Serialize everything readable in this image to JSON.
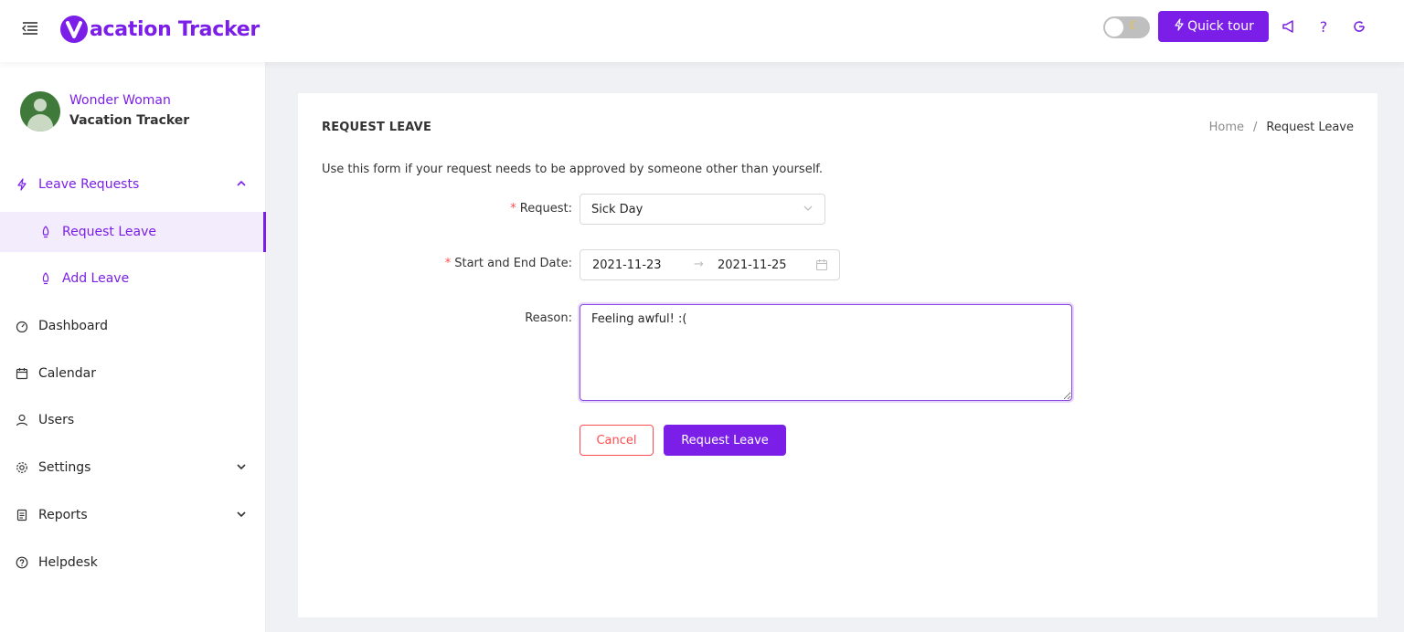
{
  "header": {
    "app_name": "acation Tracker",
    "logo_letter": "V",
    "theme_toggle": {
      "icon": "moon-icon",
      "state": "off"
    },
    "quick_tour_label": "Quick tour",
    "icons": [
      "megaphone-icon",
      "help-icon",
      "refresh-icon"
    ],
    "accent_color": "#7b1fe8"
  },
  "sidebar": {
    "user": {
      "name": "Wonder Woman",
      "company": "Vacation Tracker"
    },
    "items": [
      {
        "label": "Leave Requests",
        "icon": "lightning-icon",
        "expanded": true
      },
      {
        "label": "Request Leave",
        "icon": "rocket-icon",
        "active": true
      },
      {
        "label": "Add Leave",
        "icon": "rocket-icon"
      },
      {
        "label": "Dashboard",
        "icon": "dashboard-icon"
      },
      {
        "label": "Calendar",
        "icon": "calendar-icon"
      },
      {
        "label": "Users",
        "icon": "user-icon"
      },
      {
        "label": "Settings",
        "icon": "gear-icon",
        "expandable": true
      },
      {
        "label": "Reports",
        "icon": "report-icon",
        "expandable": true
      },
      {
        "label": "Helpdesk",
        "icon": "help-circle-icon"
      }
    ]
  },
  "main": {
    "title": "REQUEST LEAVE",
    "breadcrumb": [
      "Home",
      "/",
      "Request Leave"
    ],
    "intro": "Use this form if your request needs to be approved by someone other than yourself.",
    "form": {
      "request_label": "Request",
      "request_value": "Sick Day",
      "dates_label": "Start and End Date",
      "start_date": "2021-11-23",
      "end_date": "2021-11-25",
      "reason_label": "Reason",
      "reason_value": "Feeling awful! :(",
      "cancel_label": "Cancel",
      "submit_label": "Request Leave"
    }
  }
}
